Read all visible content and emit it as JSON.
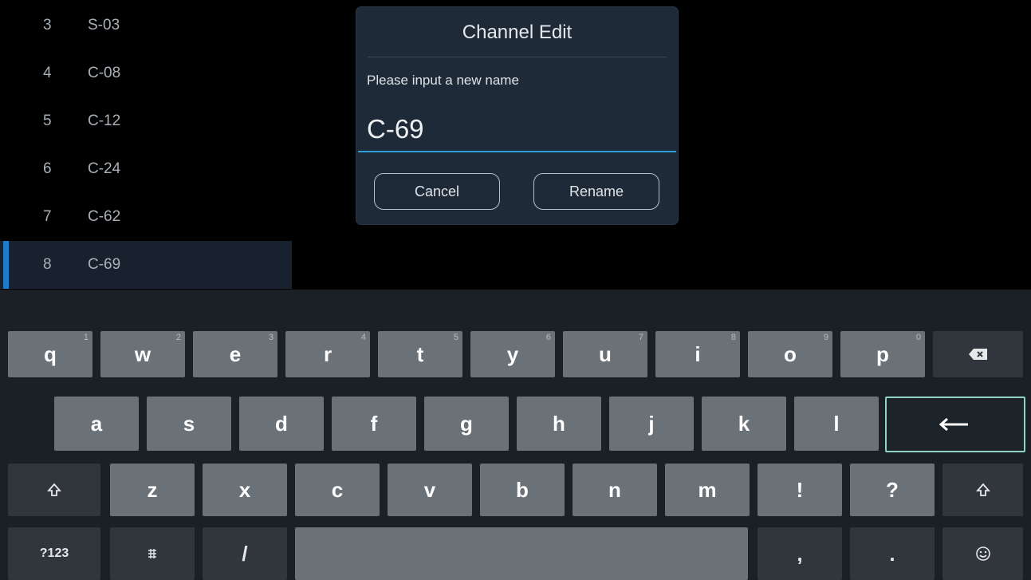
{
  "channel_list": [
    {
      "num": "3",
      "name": "S-03"
    },
    {
      "num": "4",
      "name": "C-08"
    },
    {
      "num": "5",
      "name": "C-12"
    },
    {
      "num": "6",
      "name": "C-24"
    },
    {
      "num": "7",
      "name": "C-62"
    },
    {
      "num": "8",
      "name": "C-69",
      "selected": true
    }
  ],
  "dialog": {
    "title": "Channel Edit",
    "prompt": "Please input a new name",
    "input_value": "C-69",
    "cancel_label": "Cancel",
    "rename_label": "Rename"
  },
  "keyboard": {
    "row1": [
      {
        "label": "q",
        "hint": "1"
      },
      {
        "label": "w",
        "hint": "2"
      },
      {
        "label": "e",
        "hint": "3"
      },
      {
        "label": "r",
        "hint": "4"
      },
      {
        "label": "t",
        "hint": "5"
      },
      {
        "label": "y",
        "hint": "6"
      },
      {
        "label": "u",
        "hint": "7"
      },
      {
        "label": "i",
        "hint": "8"
      },
      {
        "label": "o",
        "hint": "9"
      },
      {
        "label": "p",
        "hint": "0"
      }
    ],
    "row2": [
      "a",
      "s",
      "d",
      "f",
      "g",
      "h",
      "j",
      "k",
      "l"
    ],
    "row3": [
      "z",
      "x",
      "c",
      "v",
      "b",
      "n",
      "m",
      "!",
      "?"
    ],
    "symbols_label": "?123",
    "slash_label": "/",
    "comma_label": ",",
    "period_label": ".",
    "icons": {
      "backspace": "backspace-icon",
      "enter": "enter-arrow-icon",
      "shift": "shift-arrow-icon",
      "settings": "keyboard-settings-icon",
      "emoji": "smiley-icon"
    },
    "enter_accent": "#8fd3c6"
  },
  "colors": {
    "selection_bar": "#1e7bc8",
    "input_underline": "#2e9fd6"
  }
}
